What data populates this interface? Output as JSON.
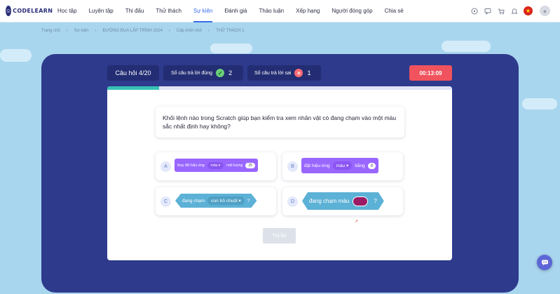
{
  "brand": {
    "logo_text": "CODELEARN"
  },
  "nav": {
    "items": [
      {
        "label": "Học tập"
      },
      {
        "label": "Luyện tập"
      },
      {
        "label": "Thi đấu"
      },
      {
        "label": "Thử thách"
      },
      {
        "label": "Sự kiện",
        "active": true
      },
      {
        "label": "Đánh giá"
      },
      {
        "label": "Thảo luận"
      },
      {
        "label": "Xếp hạng"
      },
      {
        "label": "Người đóng góp"
      },
      {
        "label": "Chia sẻ"
      }
    ],
    "icons": [
      "help-icon",
      "chat-icon",
      "cart-icon",
      "bell-icon",
      "vietnam-flag-icon",
      "user-avatar-icon"
    ]
  },
  "breadcrumb": [
    "Trang chủ",
    "Sự kiện",
    "ĐƯỜNG ĐUA LẬP TRÌNH 2024",
    "Cấp khởi chớ",
    "THỬ THÁCH 1"
  ],
  "stats": {
    "question": "Câu hỏi 4/20",
    "correct_label": "Số câu trả lời đúng",
    "correct_count": "2",
    "wrong_label": "Số câu trả lời sai",
    "wrong_count": "1",
    "timer": "00:13:09"
  },
  "progress": 0.15,
  "question": {
    "text": "Khối lệnh nào trong Scratch giúp bạn kiểm tra xem nhân vật có đang chạm vào một màu sắc nhất định hay không?"
  },
  "options": {
    "a": {
      "letter": "A",
      "part1": "thay đổi hiệu ứng",
      "dropdown": "màu",
      "part2": "một lượng",
      "value": "25"
    },
    "b": {
      "letter": "B",
      "part1": "đặt hiệu ứng",
      "dropdown": "màu",
      "part2": "bằng",
      "value": "0"
    },
    "c": {
      "letter": "C",
      "part1": "đang chạm",
      "dropdown": "con trỏ chuột",
      "suffix": "?"
    },
    "d": {
      "letter": "D",
      "part1": "đang chạm màu",
      "suffix": "?"
    }
  },
  "submit_label": "Trả lời",
  "colors": {
    "panel": "#2e3a8c",
    "timer": "#f0535d",
    "active_nav": "#3a6ee8",
    "scratch_looks": "#9966ff",
    "scratch_sensing": "#5cb1d6",
    "progress": "#36c2b5"
  }
}
